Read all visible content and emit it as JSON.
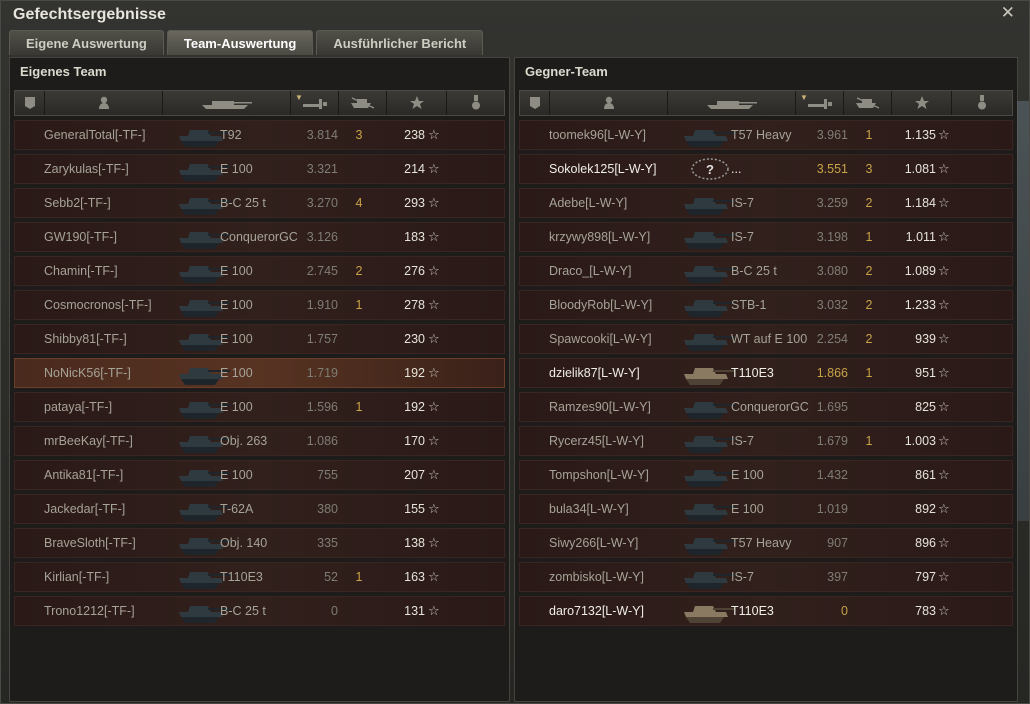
{
  "window": {
    "title": "Gefechtsergebnisse"
  },
  "tabs": [
    {
      "label": "Eigene Auswertung",
      "active": false
    },
    {
      "label": "Team-Auswertung",
      "active": true
    },
    {
      "label": "Ausführlicher Bericht",
      "active": false
    }
  ],
  "icons": {
    "close": "close-icon",
    "star": "☆"
  },
  "colors": {
    "accent": "#c9a347",
    "row_bg": "#31201c",
    "highlight": "#573322"
  },
  "own_team": {
    "title": "Eigenes Team",
    "players": [
      {
        "name": "GeneralTotal[-TF-]",
        "tank": "T92",
        "damage": "3.814",
        "kills": "3",
        "xp": "238",
        "alive": false,
        "highlight": false,
        "unknown": false
      },
      {
        "name": "Zarykulas[-TF-]",
        "tank": "E 100",
        "damage": "3.321",
        "kills": "",
        "xp": "214",
        "alive": false,
        "highlight": false,
        "unknown": false
      },
      {
        "name": "Sebb2[-TF-]",
        "tank": "B-C 25 t",
        "damage": "3.270",
        "kills": "4",
        "xp": "293",
        "alive": false,
        "highlight": false,
        "unknown": false
      },
      {
        "name": "GW190[-TF-]",
        "tank": "ConquerorGC",
        "damage": "3.126",
        "kills": "",
        "xp": "183",
        "alive": false,
        "highlight": false,
        "unknown": false
      },
      {
        "name": "Chamin[-TF-]",
        "tank": "E 100",
        "damage": "2.745",
        "kills": "2",
        "xp": "276",
        "alive": false,
        "highlight": false,
        "unknown": false
      },
      {
        "name": "Cosmocronos[-TF-]",
        "tank": "E 100",
        "damage": "1.910",
        "kills": "1",
        "xp": "278",
        "alive": false,
        "highlight": false,
        "unknown": false
      },
      {
        "name": "Shibby81[-TF-]",
        "tank": "E 100",
        "damage": "1.757",
        "kills": "",
        "xp": "230",
        "alive": false,
        "highlight": false,
        "unknown": false
      },
      {
        "name": "NoNicK56[-TF-]",
        "tank": "E 100",
        "damage": "1.719",
        "kills": "",
        "xp": "192",
        "alive": false,
        "highlight": true,
        "unknown": false
      },
      {
        "name": "pataya[-TF-]",
        "tank": "E 100",
        "damage": "1.596",
        "kills": "1",
        "xp": "192",
        "alive": false,
        "highlight": false,
        "unknown": false
      },
      {
        "name": "mrBeeKay[-TF-]",
        "tank": "Obj. 263",
        "damage": "1.086",
        "kills": "",
        "xp": "170",
        "alive": false,
        "highlight": false,
        "unknown": false
      },
      {
        "name": "Antika81[-TF-]",
        "tank": "E 100",
        "damage": "755",
        "kills": "",
        "xp": "207",
        "alive": false,
        "highlight": false,
        "unknown": false
      },
      {
        "name": "Jackedar[-TF-]",
        "tank": "T-62A",
        "damage": "380",
        "kills": "",
        "xp": "155",
        "alive": false,
        "highlight": false,
        "unknown": false
      },
      {
        "name": "BraveSloth[-TF-]",
        "tank": "Obj. 140",
        "damage": "335",
        "kills": "",
        "xp": "138",
        "alive": false,
        "highlight": false,
        "unknown": false
      },
      {
        "name": "Kirlian[-TF-]",
        "tank": "T110E3",
        "damage": "52",
        "kills": "1",
        "xp": "163",
        "alive": false,
        "highlight": false,
        "unknown": false
      },
      {
        "name": "Trono1212[-TF-]",
        "tank": "B-C 25 t",
        "damage": "0",
        "kills": "",
        "xp": "131",
        "alive": false,
        "highlight": false,
        "unknown": false
      }
    ]
  },
  "enemy_team": {
    "title": "Gegner-Team",
    "players": [
      {
        "name": "toomek96[L-W-Y]",
        "tank": "T57 Heavy",
        "damage": "3.961",
        "kills": "1",
        "xp": "1.135",
        "alive": false,
        "highlight": false,
        "unknown": false
      },
      {
        "name": "Sokolek125[L-W-Y]",
        "tank": "...",
        "damage": "3.551",
        "kills": "3",
        "xp": "1.081",
        "alive": true,
        "highlight": false,
        "unknown": true
      },
      {
        "name": "Adebe[L-W-Y]",
        "tank": "IS-7",
        "damage": "3.259",
        "kills": "2",
        "xp": "1.184",
        "alive": false,
        "highlight": false,
        "unknown": false
      },
      {
        "name": "krzywy898[L-W-Y]",
        "tank": "IS-7",
        "damage": "3.198",
        "kills": "1",
        "xp": "1.011",
        "alive": false,
        "highlight": false,
        "unknown": false
      },
      {
        "name": "Draco_[L-W-Y]",
        "tank": "B-C 25 t",
        "damage": "3.080",
        "kills": "2",
        "xp": "1.089",
        "alive": false,
        "highlight": false,
        "unknown": false
      },
      {
        "name": "BloodyRob[L-W-Y]",
        "tank": "STB-1",
        "damage": "3.032",
        "kills": "2",
        "xp": "1.233",
        "alive": false,
        "highlight": false,
        "unknown": false
      },
      {
        "name": "Spawcooki[L-W-Y]",
        "tank": "WT auf E 100",
        "damage": "2.254",
        "kills": "2",
        "xp": "939",
        "alive": false,
        "highlight": false,
        "unknown": false
      },
      {
        "name": "dzielik87[L-W-Y]",
        "tank": "T110E3",
        "damage": "1.866",
        "kills": "1",
        "xp": "951",
        "alive": true,
        "highlight": false,
        "unknown": false
      },
      {
        "name": "Ramzes90[L-W-Y]",
        "tank": "ConquerorGC",
        "damage": "1.695",
        "kills": "",
        "xp": "825",
        "alive": false,
        "highlight": false,
        "unknown": false
      },
      {
        "name": "Rycerz45[L-W-Y]",
        "tank": "IS-7",
        "damage": "1.679",
        "kills": "1",
        "xp": "1.003",
        "alive": false,
        "highlight": false,
        "unknown": false
      },
      {
        "name": "Tompshon[L-W-Y]",
        "tank": "E 100",
        "damage": "1.432",
        "kills": "",
        "xp": "861",
        "alive": false,
        "highlight": false,
        "unknown": false
      },
      {
        "name": "bula34[L-W-Y]",
        "tank": "E 100",
        "damage": "1.019",
        "kills": "",
        "xp": "892",
        "alive": false,
        "highlight": false,
        "unknown": false
      },
      {
        "name": "Siwy266[L-W-Y]",
        "tank": "T57 Heavy",
        "damage": "907",
        "kills": "",
        "xp": "896",
        "alive": false,
        "highlight": false,
        "unknown": false
      },
      {
        "name": "zombisko[L-W-Y]",
        "tank": "IS-7",
        "damage": "397",
        "kills": "",
        "xp": "797",
        "alive": false,
        "highlight": false,
        "unknown": false
      },
      {
        "name": "daro7132[L-W-Y]",
        "tank": "T110E3",
        "damage": "0",
        "kills": "",
        "xp": "783",
        "alive": true,
        "highlight": false,
        "unknown": false
      }
    ]
  }
}
